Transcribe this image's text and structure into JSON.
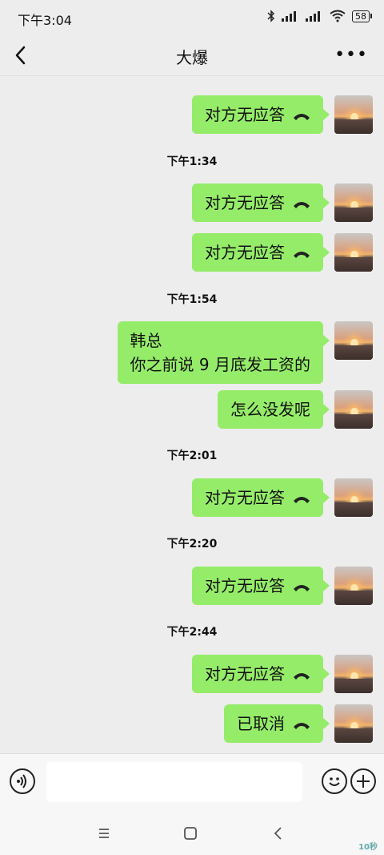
{
  "status_bar": {
    "time": "下午3:04",
    "battery": "58"
  },
  "header": {
    "title": "大爆"
  },
  "messages": [
    {
      "type": "call",
      "text": "对方无应答"
    },
    {
      "type": "timestamp",
      "text": "下午1:34"
    },
    {
      "type": "call",
      "text": "对方无应答"
    },
    {
      "type": "call",
      "text": "对方无应答"
    },
    {
      "type": "timestamp",
      "text": "下午1:54"
    },
    {
      "type": "text",
      "line1": "韩总",
      "line2": "你之前说 9 月底发工资的"
    },
    {
      "type": "text",
      "text": "怎么没发呢"
    },
    {
      "type": "timestamp",
      "text": "下午2:01"
    },
    {
      "type": "call",
      "text": "对方无应答"
    },
    {
      "type": "timestamp",
      "text": "下午2:20"
    },
    {
      "type": "call",
      "text": "对方无应答"
    },
    {
      "type": "timestamp",
      "text": "下午2:44"
    },
    {
      "type": "call",
      "text": "对方无应答"
    },
    {
      "type": "call",
      "text": "已取消"
    }
  ],
  "input": {
    "placeholder": ""
  },
  "icons": {
    "back": "chevron-left-icon",
    "more": "more-icon",
    "phone": "phone-hangup-icon",
    "voice": "voice-icon",
    "emoji": "emoji-icon",
    "plus": "plus-icon"
  },
  "colors": {
    "bubble": "#95ec69",
    "background": "#ededed"
  },
  "watermark": "10秒"
}
